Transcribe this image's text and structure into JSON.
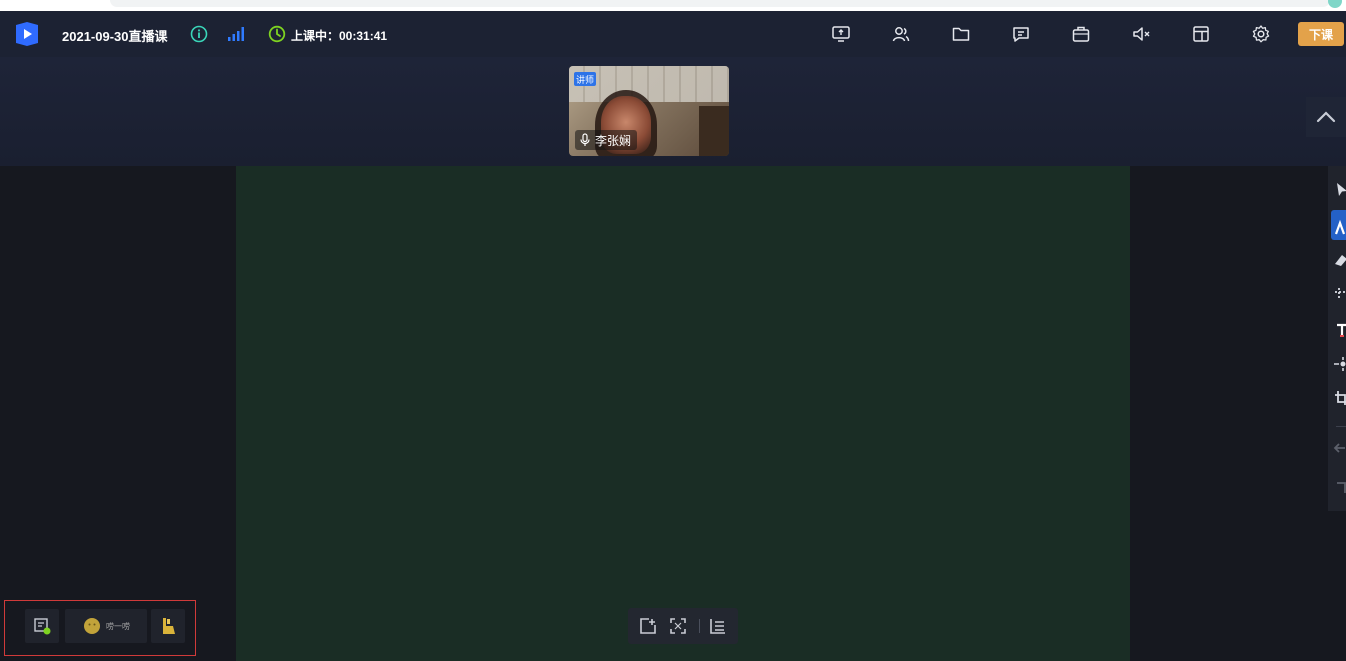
{
  "header": {
    "title": "2021-09-30直播课",
    "class_status": "上课中：00:31:41",
    "end_class_label": "下课",
    "toolbar_icons": [
      "screen-share-icon",
      "members-icon",
      "folder-icon",
      "chat-icon",
      "toolbox-icon",
      "speaker-mute-icon",
      "layout-icon",
      "settings-icon"
    ]
  },
  "video": {
    "role_badge": "讲师",
    "teacher_name": "李张娴"
  },
  "bottom": {
    "interact_label": "唠一唠"
  },
  "colors": {
    "topbar": "#1c2233",
    "whiteboard": "#1a2d25",
    "accent_blue": "#2461c7",
    "end_class": "#e3a24a",
    "status_green": "#7ed321",
    "info_teal": "#3ad6b9",
    "signal_blue": "#2f7bff"
  }
}
